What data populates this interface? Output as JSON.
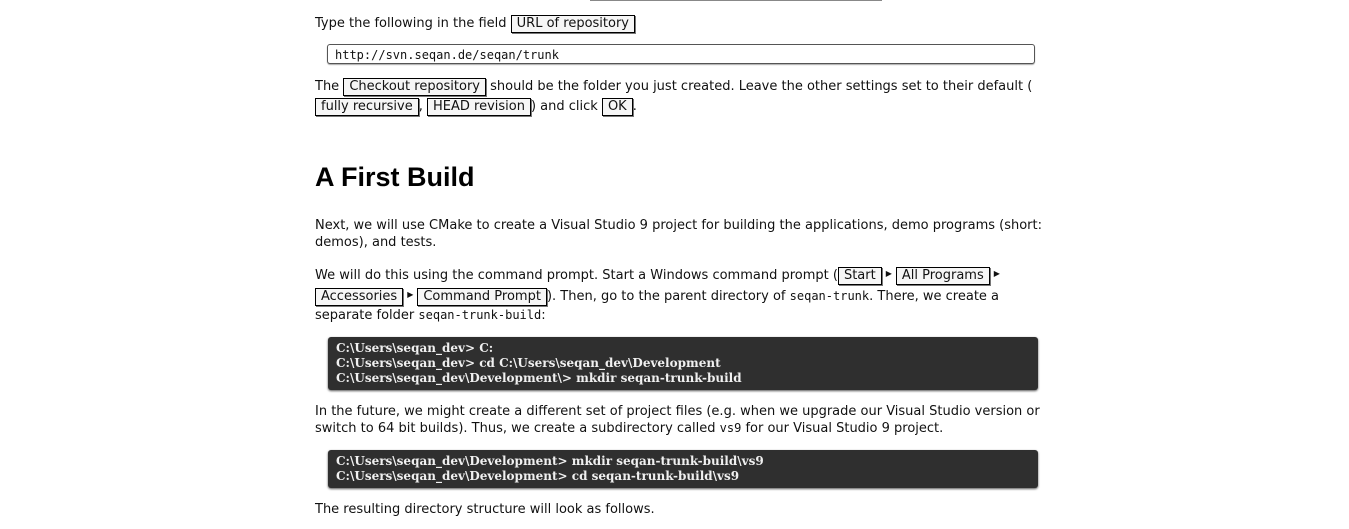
{
  "section1": {
    "prefix": "Type the following in the field ",
    "field_label": "URL of repository",
    "url_value": "http://svn.seqan.de/seqan/trunk",
    "p2_prefix": "The ",
    "checkout_label": "Checkout repository",
    "p2_middle": " should be the folder you just created. Leave the other settings set to their default (",
    "recursive_label": "fully recursive",
    "comma": ", ",
    "head_label": "HEAD revision",
    "p2_click": ") and click ",
    "ok_label": "OK",
    "period": "."
  },
  "heading": "A First Build",
  "para_intro": "Next, we will use CMake to create a Visual Studio 9 project for building the applications, demo programs (short: demos), and tests.",
  "para_prompt": {
    "prefix": "We will do this using the command prompt. Start a Windows command prompt (",
    "menu": [
      "Start",
      "All Programs",
      "Accessories",
      "Command Prompt"
    ],
    "middle": "). Then, go to the parent directory of ",
    "code1": "seqan-trunk",
    "middle2": ". There, we create a separate folder ",
    "code2": "seqan-trunk-build",
    "suffix": ":"
  },
  "code_block_1": [
    "C:\\Users\\seqan_dev> C:",
    "C:\\Users\\seqan_dev> cd C:\\Users\\seqan_dev\\Development",
    "C:\\Users\\seqan_dev\\Development\\> mkdir seqan-trunk-build"
  ],
  "para_future": {
    "prefix": "In the future, we might create a different set of project files (e.g. when we upgrade our Visual Studio version or switch to 64 bit builds). Thus, we create a subdirectory called ",
    "code": "vs9",
    "suffix": " for our Visual Studio 9 project."
  },
  "code_block_2": [
    "C:\\Users\\seqan_dev\\Development> mkdir seqan-trunk-build\\vs9",
    "C:\\Users\\seqan_dev\\Development> cd seqan-trunk-build\\vs9"
  ],
  "para_result": "The resulting directory structure will look as follows."
}
